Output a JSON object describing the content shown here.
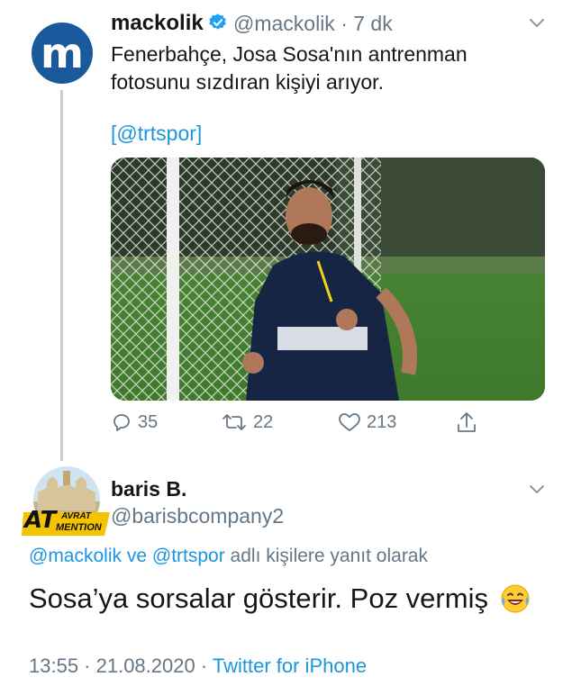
{
  "tweet": {
    "author_name": "mackolik",
    "author_handle": "@mackolik",
    "time_ago": "· 7 dk",
    "text": "Fenerbahçe, Josa Sosa'nın antrenman fotosunu sızdıran kişiyi arıyor.",
    "bracket_open": "[",
    "bracket_link": "@trtspor",
    "bracket_close": "]",
    "avatar_letter": "m",
    "stats": {
      "replies": "35",
      "retweets": "22",
      "likes": "213"
    },
    "icons": [
      "verified-badge-icon",
      "chevron-down-icon",
      "reply-icon",
      "retweet-icon",
      "like-icon",
      "share-icon"
    ]
  },
  "reply": {
    "author_name": "baris B.",
    "author_handle": "@barisbcompany2",
    "replying_link1": "@mackolik",
    "replying_ve": " ve ",
    "replying_link2": "@trtspor",
    "replying_suffix": " adlı kişilere yanıt olarak",
    "text": "Sosa’ya sorsalar gösterir. Poz vermiş",
    "avatar_text_at": "AT",
    "avatar_text_avrat": "AVRAT",
    "avatar_text_mention": "MENTION",
    "timestamp": "13:55 · 21.08.2020 · ",
    "source": "Twitter for iPhone"
  },
  "colors": {
    "link": "#1b95e0",
    "secondary_text": "#657786",
    "brand_blue": "#1a5a9c",
    "verified": "#1da1f2"
  }
}
